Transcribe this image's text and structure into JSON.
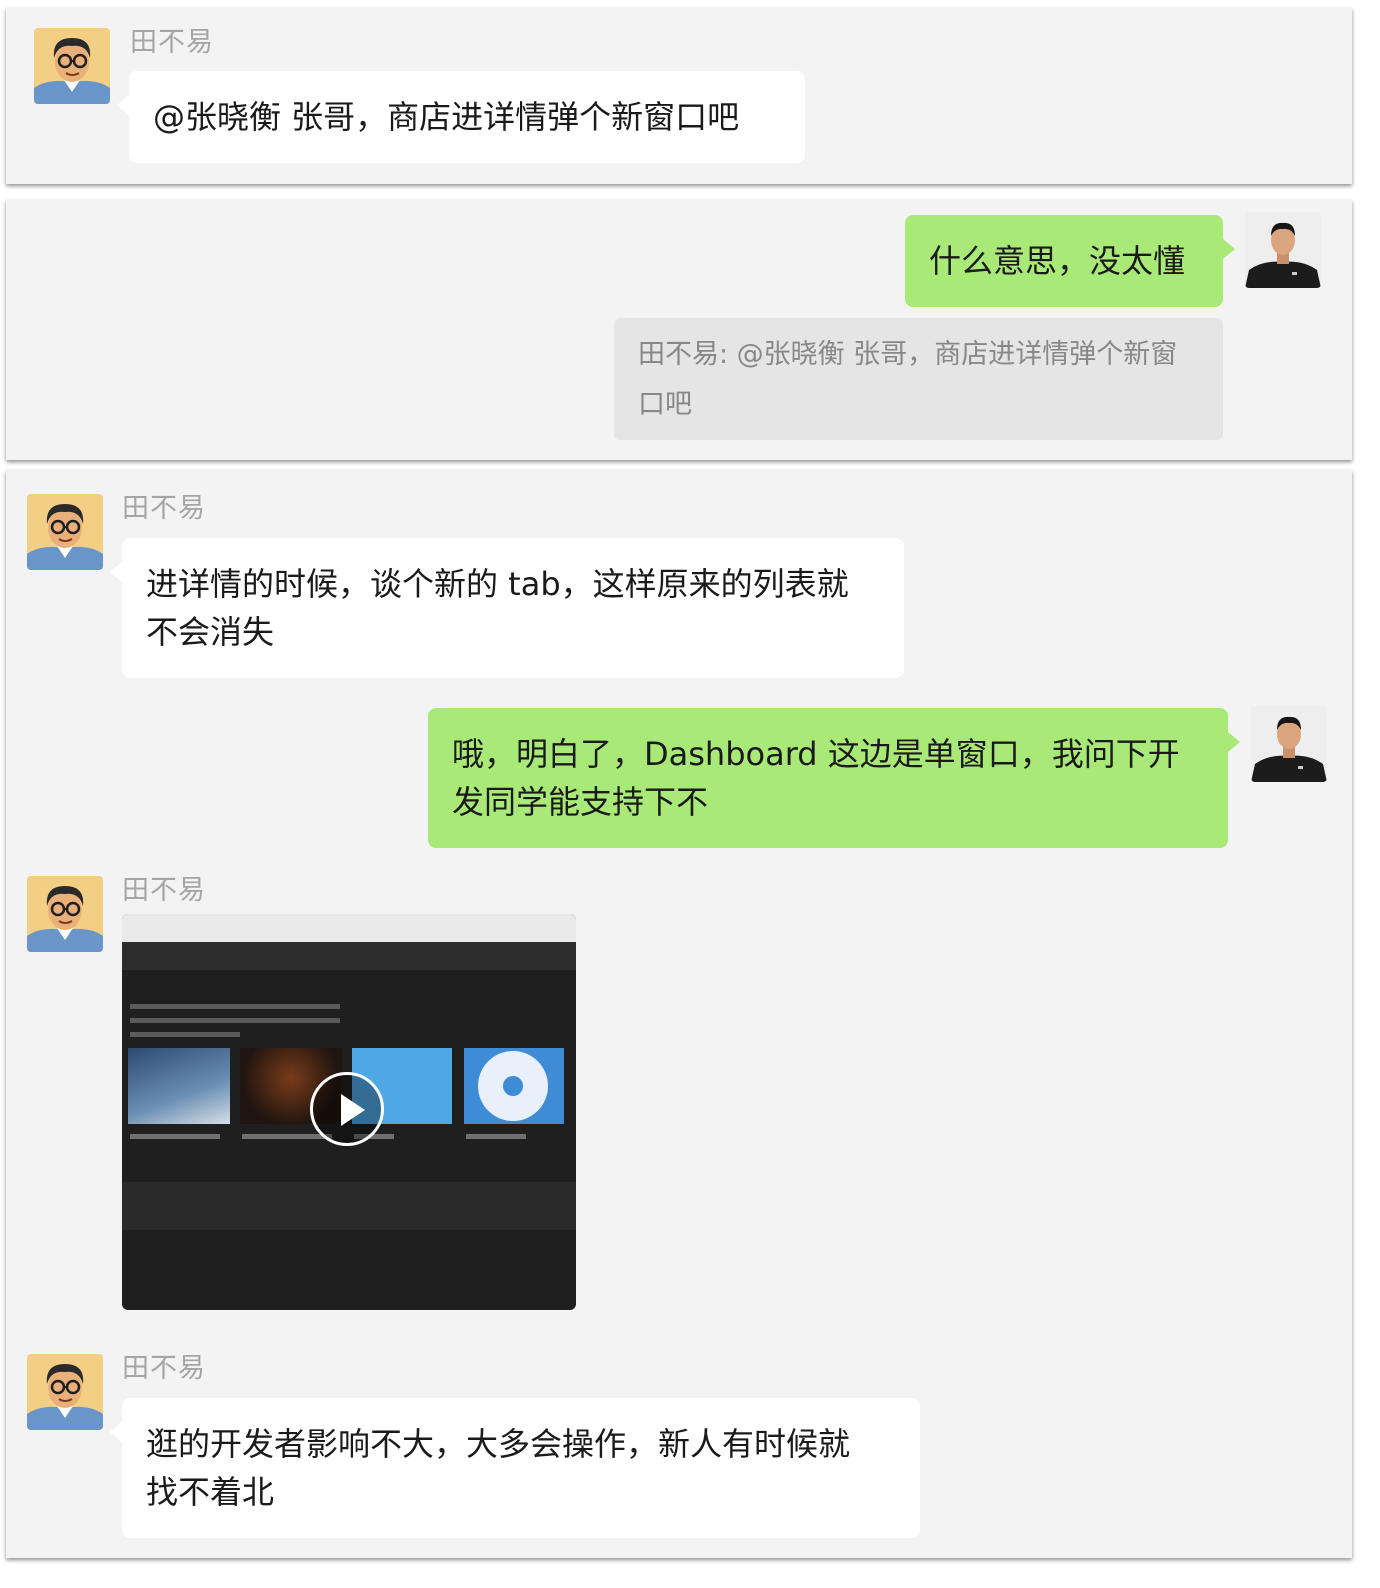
{
  "messages": {
    "m1": {
      "sender": "田不易",
      "text": "@张晓衡 张哥，商店进详情弹个新窗口吧"
    },
    "m2": {
      "text": "什么意思，没太懂",
      "quote": {
        "line1": "田不易: @张晓衡 张哥，商店进详情弹个新窗",
        "line2": "口吧"
      }
    },
    "m3": {
      "sender": "田不易",
      "line1": "进详情的时候，谈个新的 tab，这样原来的列表就",
      "line2": "不会消失"
    },
    "m4": {
      "line1": "哦，明白了，Dashboard 这边是单窗口，我问下开",
      "line2": "发同学能支持下不"
    },
    "m5": {
      "sender": "田不易",
      "media": "video"
    },
    "m6": {
      "sender": "田不易",
      "line1": "逛的开发者影响不大，大多会操作，新人有时候就",
      "line2": "找不着北"
    }
  },
  "colors": {
    "background": "#f3f3f3",
    "self_bubble": "#a9e977",
    "other_bubble": "#ffffff",
    "quote": "#e5e5e5"
  },
  "icons": {
    "video_play": "play-icon"
  }
}
